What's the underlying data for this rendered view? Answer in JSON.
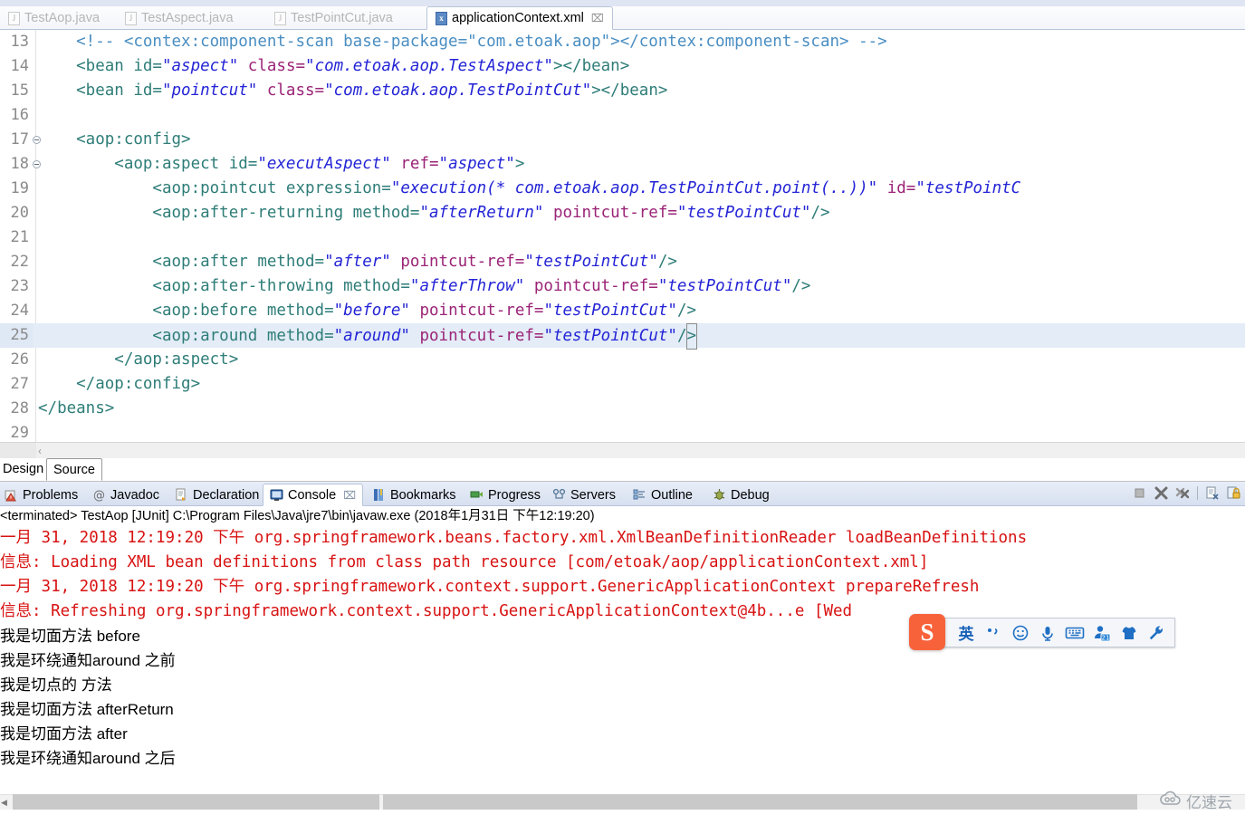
{
  "editor_tabs": [
    {
      "label": "TestAop.java",
      "icon": "java-file-icon",
      "active": false,
      "closable": false
    },
    {
      "label": "TestAspect.java",
      "icon": "java-file-icon",
      "active": false,
      "closable": false
    },
    {
      "label": "TestPointCut.java",
      "icon": "java-file-icon",
      "active": false,
      "closable": false
    },
    {
      "label": "applicationContext.xml",
      "icon": "xml-file-icon",
      "active": true,
      "closable": true
    }
  ],
  "tab_icon_glyphs": {
    "java": "J",
    "xml": "x"
  },
  "close_glyph": "⌧",
  "code_lines": [
    {
      "num": "13",
      "folding": false,
      "highlighted": false
    },
    {
      "num": "14",
      "folding": false,
      "highlighted": false
    },
    {
      "num": "15",
      "folding": false,
      "highlighted": false
    },
    {
      "num": "16",
      "folding": false,
      "highlighted": false
    },
    {
      "num": "17",
      "folding": true,
      "highlighted": false
    },
    {
      "num": "18",
      "folding": true,
      "highlighted": false
    },
    {
      "num": "19",
      "folding": false,
      "highlighted": false
    },
    {
      "num": "20",
      "folding": false,
      "highlighted": false
    },
    {
      "num": "21",
      "folding": false,
      "highlighted": false
    },
    {
      "num": "22",
      "folding": false,
      "highlighted": false
    },
    {
      "num": "23",
      "folding": false,
      "highlighted": false
    },
    {
      "num": "24",
      "folding": false,
      "highlighted": false
    },
    {
      "num": "25",
      "folding": false,
      "highlighted": true
    },
    {
      "num": "26",
      "folding": false,
      "highlighted": false
    },
    {
      "num": "27",
      "folding": false,
      "highlighted": false
    },
    {
      "num": "28",
      "folding": false,
      "highlighted": false
    },
    {
      "num": "29",
      "folding": false,
      "highlighted": false
    }
  ],
  "code_text": {
    "l13": "    <!-- <contex:component-scan base-package=\"com.etoak.aop\"></contex:component-scan> -->",
    "l14_a": "    <bean id=",
    "l14_b": "\"aspect\"",
    "l14_c": " class=",
    "l14_d": "\"com.etoak.aop.TestAspect\"",
    "l14_e": "></bean>",
    "l15_a": "    <bean id=",
    "l15_b": "\"pointcut\"",
    "l15_c": " class=",
    "l15_d": "\"com.etoak.aop.TestPointCut\"",
    "l15_e": "></bean>",
    "l16": "",
    "l17": "    <aop:config>",
    "l18_a": "        <aop:aspect id=",
    "l18_b": "\"executAspect\"",
    "l18_c": " ref=",
    "l18_d": "\"aspect\"",
    "l18_e": ">",
    "l19_a": "            <aop:pointcut expression=",
    "l19_b": "\"execution(* com.etoak.aop.TestPointCut.point(..))\"",
    "l19_c": " id=",
    "l19_d": "\"testPointC",
    "l20_a": "            <aop:after-returning method=",
    "l20_b": "\"afterReturn\"",
    "l20_c": " pointcut-ref=",
    "l20_d": "\"testPointCut\"",
    "l20_e": "/>",
    "l21": "",
    "l22_a": "            <aop:after method=",
    "l22_b": "\"after\"",
    "l22_c": " pointcut-ref=",
    "l22_d": "\"testPointCut\"",
    "l22_e": "/>",
    "l23_a": "            <aop:after-throwing method=",
    "l23_b": "\"afterThrow\"",
    "l23_c": " pointcut-ref=",
    "l23_d": "\"testPointCut\"",
    "l23_e": "/>",
    "l24_a": "            <aop:before method=",
    "l24_b": "\"before\"",
    "l24_c": " pointcut-ref=",
    "l24_d": "\"testPointCut\"",
    "l24_e": "/>",
    "l25_a": "            <aop:around method=",
    "l25_b": "\"around\"",
    "l25_c": " pointcut-ref=",
    "l25_d": "\"testPointCut\"",
    "l25_e": "/",
    "l25_f": ">",
    "l26": "        </aop:aspect>",
    "l27": "    </aop:config>",
    "l28": "</beans>",
    "l29": ""
  },
  "design_source_tabs": [
    {
      "label": "Design",
      "selected": false
    },
    {
      "label": "Source",
      "selected": true
    }
  ],
  "view_tabs": [
    {
      "label": "Problems",
      "icon": "problems-icon",
      "active": false,
      "closable": false
    },
    {
      "label": "Javadoc",
      "icon": "javadoc-icon",
      "active": false,
      "closable": false
    },
    {
      "label": "Declaration",
      "icon": "declaration-icon",
      "active": false,
      "closable": false
    },
    {
      "label": "Console",
      "icon": "console-icon",
      "active": true,
      "closable": true
    },
    {
      "label": "Bookmarks",
      "icon": "bookmarks-icon",
      "active": false,
      "closable": false
    },
    {
      "label": "Progress",
      "icon": "progress-icon",
      "active": false,
      "closable": false
    },
    {
      "label": "Servers",
      "icon": "servers-icon",
      "active": false,
      "closable": false
    },
    {
      "label": "Outline",
      "icon": "outline-icon",
      "active": false,
      "closable": false
    },
    {
      "label": "Debug",
      "icon": "debug-icon",
      "active": false,
      "closable": false
    }
  ],
  "console_toolbar": [
    {
      "name": "terminate-button"
    },
    {
      "name": "remove-launch-button"
    },
    {
      "name": "remove-all-terminated-button"
    },
    {
      "name": "toolbar-separator"
    },
    {
      "name": "clear-console-button"
    },
    {
      "name": "scroll-lock-button"
    }
  ],
  "console": {
    "header": "<terminated> TestAop [JUnit] C:\\Program Files\\Java\\jre7\\bin\\javaw.exe (2018年1月31日 下午12:19:20)",
    "lines": [
      {
        "text": "一月 31, 2018 12:19:20 下午 org.springframework.beans.factory.xml.XmlBeanDefinitionReader loadBeanDefinitions",
        "stream": "err"
      },
      {
        "text": "信息: Loading XML bean definitions from class path resource [com/etoak/aop/applicationContext.xml]",
        "stream": "err"
      },
      {
        "text": "一月 31, 2018 12:19:20 下午 org.springframework.context.support.GenericApplicationContext prepareRefresh",
        "stream": "err"
      },
      {
        "text": "信息: Refreshing org.springframework.context.support.GenericApplicationContext@4b...e [Wed ",
        "stream": "err"
      },
      {
        "text": "我是切面方法 before",
        "stream": "out"
      },
      {
        "text": "我是环绕通知around 之前",
        "stream": "out"
      },
      {
        "text": "我是切点的 方法",
        "stream": "out"
      },
      {
        "text": "我是切面方法 afterReturn",
        "stream": "out"
      },
      {
        "text": "我是切面方法 after",
        "stream": "out"
      },
      {
        "text": "我是环绕通知around 之后",
        "stream": "out"
      }
    ]
  },
  "ime": {
    "logo": "S",
    "items": [
      {
        "name": "ime-language-toggle",
        "glyph": "英"
      },
      {
        "name": "ime-punctuation-toggle",
        "glyph": "•,"
      },
      {
        "name": "ime-emoji-button",
        "glyph": "☺"
      },
      {
        "name": "ime-voice-input-button",
        "glyph": "Ἲ4"
      },
      {
        "name": "ime-soft-keyboard-button",
        "glyph": "⌨"
      },
      {
        "name": "ime-user-center-button",
        "glyph": "21"
      },
      {
        "name": "ime-skin-button",
        "glyph": "☁"
      },
      {
        "name": "ime-tools-button",
        "glyph": "ὒ7"
      }
    ]
  },
  "watermark": {
    "text": "亿速云"
  },
  "colors": {
    "tag": "#2e7d78",
    "attribute": "#9b2477",
    "value": "#2424d6",
    "comment": "#4a8ec2",
    "console_error": "#d81212",
    "console_out": "#000000",
    "line_highlight": "#e3ecf7",
    "ime_accent": "#f8623a"
  }
}
